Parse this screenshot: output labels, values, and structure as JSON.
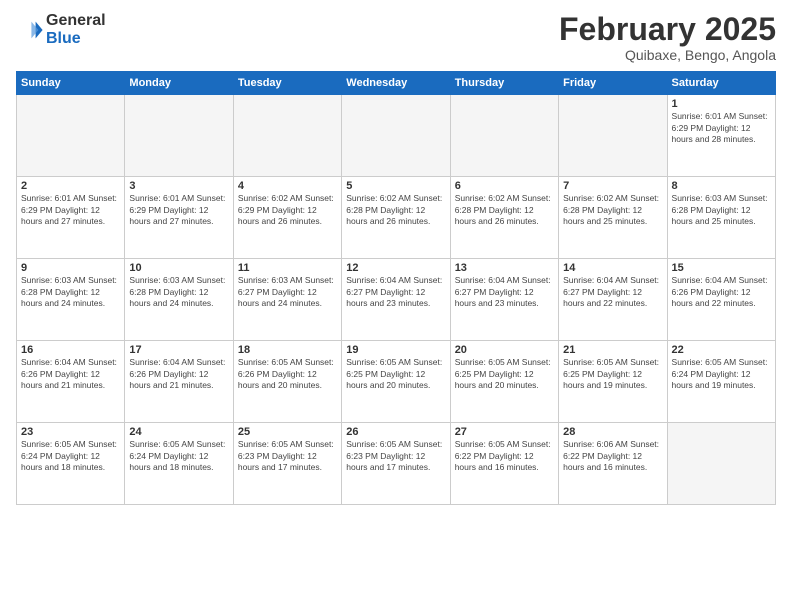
{
  "logo": {
    "general": "General",
    "blue": "Blue"
  },
  "header": {
    "month_year": "February 2025",
    "location": "Quibaxe, Bengo, Angola"
  },
  "weekdays": [
    "Sunday",
    "Monday",
    "Tuesday",
    "Wednesday",
    "Thursday",
    "Friday",
    "Saturday"
  ],
  "weeks": [
    [
      {
        "day": "",
        "info": ""
      },
      {
        "day": "",
        "info": ""
      },
      {
        "day": "",
        "info": ""
      },
      {
        "day": "",
        "info": ""
      },
      {
        "day": "",
        "info": ""
      },
      {
        "day": "",
        "info": ""
      },
      {
        "day": "1",
        "info": "Sunrise: 6:01 AM\nSunset: 6:29 PM\nDaylight: 12 hours and 28 minutes."
      }
    ],
    [
      {
        "day": "2",
        "info": "Sunrise: 6:01 AM\nSunset: 6:29 PM\nDaylight: 12 hours and 27 minutes."
      },
      {
        "day": "3",
        "info": "Sunrise: 6:01 AM\nSunset: 6:29 PM\nDaylight: 12 hours and 27 minutes."
      },
      {
        "day": "4",
        "info": "Sunrise: 6:02 AM\nSunset: 6:29 PM\nDaylight: 12 hours and 26 minutes."
      },
      {
        "day": "5",
        "info": "Sunrise: 6:02 AM\nSunset: 6:28 PM\nDaylight: 12 hours and 26 minutes."
      },
      {
        "day": "6",
        "info": "Sunrise: 6:02 AM\nSunset: 6:28 PM\nDaylight: 12 hours and 26 minutes."
      },
      {
        "day": "7",
        "info": "Sunrise: 6:02 AM\nSunset: 6:28 PM\nDaylight: 12 hours and 25 minutes."
      },
      {
        "day": "8",
        "info": "Sunrise: 6:03 AM\nSunset: 6:28 PM\nDaylight: 12 hours and 25 minutes."
      }
    ],
    [
      {
        "day": "9",
        "info": "Sunrise: 6:03 AM\nSunset: 6:28 PM\nDaylight: 12 hours and 24 minutes."
      },
      {
        "day": "10",
        "info": "Sunrise: 6:03 AM\nSunset: 6:28 PM\nDaylight: 12 hours and 24 minutes."
      },
      {
        "day": "11",
        "info": "Sunrise: 6:03 AM\nSunset: 6:27 PM\nDaylight: 12 hours and 24 minutes."
      },
      {
        "day": "12",
        "info": "Sunrise: 6:04 AM\nSunset: 6:27 PM\nDaylight: 12 hours and 23 minutes."
      },
      {
        "day": "13",
        "info": "Sunrise: 6:04 AM\nSunset: 6:27 PM\nDaylight: 12 hours and 23 minutes."
      },
      {
        "day": "14",
        "info": "Sunrise: 6:04 AM\nSunset: 6:27 PM\nDaylight: 12 hours and 22 minutes."
      },
      {
        "day": "15",
        "info": "Sunrise: 6:04 AM\nSunset: 6:26 PM\nDaylight: 12 hours and 22 minutes."
      }
    ],
    [
      {
        "day": "16",
        "info": "Sunrise: 6:04 AM\nSunset: 6:26 PM\nDaylight: 12 hours and 21 minutes."
      },
      {
        "day": "17",
        "info": "Sunrise: 6:04 AM\nSunset: 6:26 PM\nDaylight: 12 hours and 21 minutes."
      },
      {
        "day": "18",
        "info": "Sunrise: 6:05 AM\nSunset: 6:26 PM\nDaylight: 12 hours and 20 minutes."
      },
      {
        "day": "19",
        "info": "Sunrise: 6:05 AM\nSunset: 6:25 PM\nDaylight: 12 hours and 20 minutes."
      },
      {
        "day": "20",
        "info": "Sunrise: 6:05 AM\nSunset: 6:25 PM\nDaylight: 12 hours and 20 minutes."
      },
      {
        "day": "21",
        "info": "Sunrise: 6:05 AM\nSunset: 6:25 PM\nDaylight: 12 hours and 19 minutes."
      },
      {
        "day": "22",
        "info": "Sunrise: 6:05 AM\nSunset: 6:24 PM\nDaylight: 12 hours and 19 minutes."
      }
    ],
    [
      {
        "day": "23",
        "info": "Sunrise: 6:05 AM\nSunset: 6:24 PM\nDaylight: 12 hours and 18 minutes."
      },
      {
        "day": "24",
        "info": "Sunrise: 6:05 AM\nSunset: 6:24 PM\nDaylight: 12 hours and 18 minutes."
      },
      {
        "day": "25",
        "info": "Sunrise: 6:05 AM\nSunset: 6:23 PM\nDaylight: 12 hours and 17 minutes."
      },
      {
        "day": "26",
        "info": "Sunrise: 6:05 AM\nSunset: 6:23 PM\nDaylight: 12 hours and 17 minutes."
      },
      {
        "day": "27",
        "info": "Sunrise: 6:05 AM\nSunset: 6:22 PM\nDaylight: 12 hours and 16 minutes."
      },
      {
        "day": "28",
        "info": "Sunrise: 6:06 AM\nSunset: 6:22 PM\nDaylight: 12 hours and 16 minutes."
      },
      {
        "day": "",
        "info": ""
      }
    ]
  ]
}
